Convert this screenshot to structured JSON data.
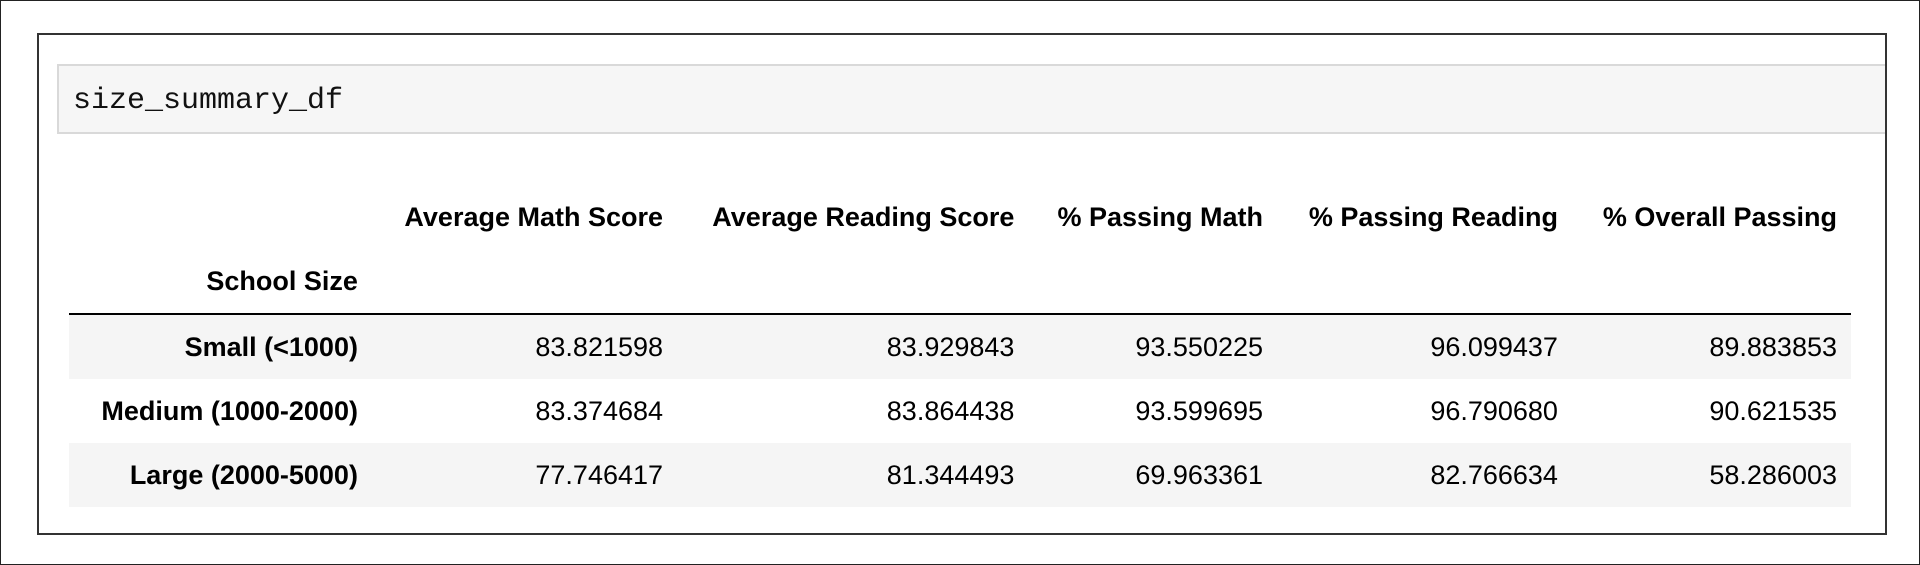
{
  "cell": {
    "code": "size_summary_df"
  },
  "table": {
    "index_name": "School Size",
    "columns": [
      "Average Math Score",
      "Average Reading Score",
      "% Passing Math",
      "% Passing Reading",
      "% Overall Passing"
    ],
    "rows": [
      {
        "label": "Small (<1000)",
        "values": [
          "83.821598",
          "83.929843",
          "93.550225",
          "96.099437",
          "89.883853"
        ]
      },
      {
        "label": "Medium (1000-2000)",
        "values": [
          "83.374684",
          "83.864438",
          "93.599695",
          "96.790680",
          "90.621535"
        ]
      },
      {
        "label": "Large (2000-5000)",
        "values": [
          "77.746417",
          "81.344493",
          "69.963361",
          "82.766634",
          "58.286003"
        ]
      }
    ]
  }
}
